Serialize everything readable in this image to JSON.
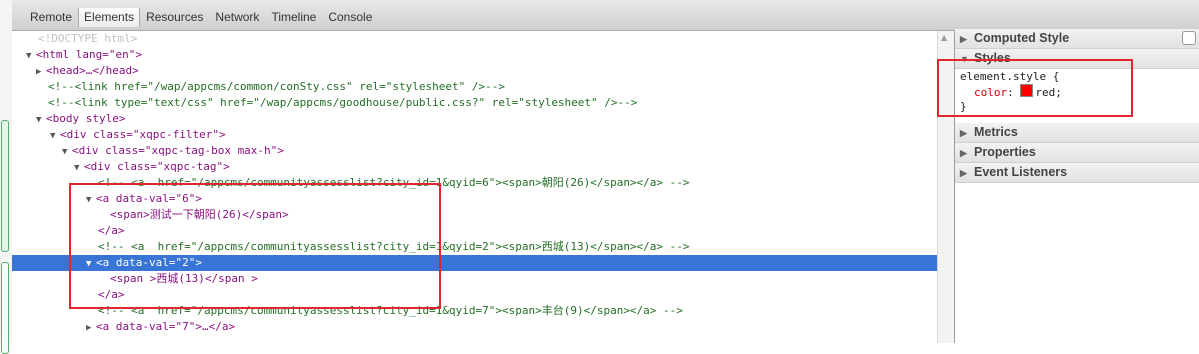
{
  "toolbar": {
    "tabs": [
      "Remote",
      "Elements",
      "Resources",
      "Network",
      "Timeline",
      "Console"
    ],
    "selected_tab": "Elements"
  },
  "dom_lines": [
    {
      "t": "<!DOCTYPE html>"
    },
    {
      "t": "<html lang=\"en\">"
    },
    {
      "t": "<head>…</head>"
    },
    {
      "t": "<!--<link href=\"/wap/appcms/common/conSty.css\" rel=\"stylesheet\" />-->"
    },
    {
      "t": "<!--<link type=\"text/css\" href=\"/wap/appcms/goodhouse/public.css?\" rel=\"stylesheet\" />-->"
    },
    {
      "t": "<body style>"
    },
    {
      "t": "<div class=\"xqpc-filter\">"
    },
    {
      "t": "<div class=\"xqpc-tag-box max-h\">"
    },
    {
      "t": "<div class=\"xqpc-tag\">"
    },
    {
      "t": "<!-- <a  href=\"/appcms/communityassesslist?city_id=1&qyid=6\"><span>朝阳(26)</span></a> -->"
    },
    {
      "t": "<a data-val=\"6\">"
    },
    {
      "t": "<span>测试一下朝阳(26)</span>"
    },
    {
      "t": "</a>"
    },
    {
      "t": "<!-- <a  href=\"/appcms/communityassesslist?city_id=1&qyid=2\"><span>西城(13)</span></a> -->"
    },
    {
      "t": "<a data-val=\"2\">"
    },
    {
      "t": "<span >西城(13)</span >"
    },
    {
      "t": "</a>"
    },
    {
      "t": "<!-- <a  href=\"/appcms/communityassesslist?city_id=1&qyid=7\"><span>丰台(9)</span></a> -->"
    },
    {
      "t": "<a data-val=\"7\">…</a>"
    }
  ],
  "sidebar": {
    "computed_style": "Computed Style",
    "styles": "Styles",
    "rule_selector": "element.style {",
    "rule_prop": "color",
    "rule_value": "red;",
    "rule_close": "}",
    "metrics": "Metrics",
    "properties": "Properties",
    "event_listeners": "Event Listeners"
  },
  "colors": {
    "selection": "#3875d7",
    "annotation_red": "#e0262e",
    "swatch": "#ff0000"
  }
}
